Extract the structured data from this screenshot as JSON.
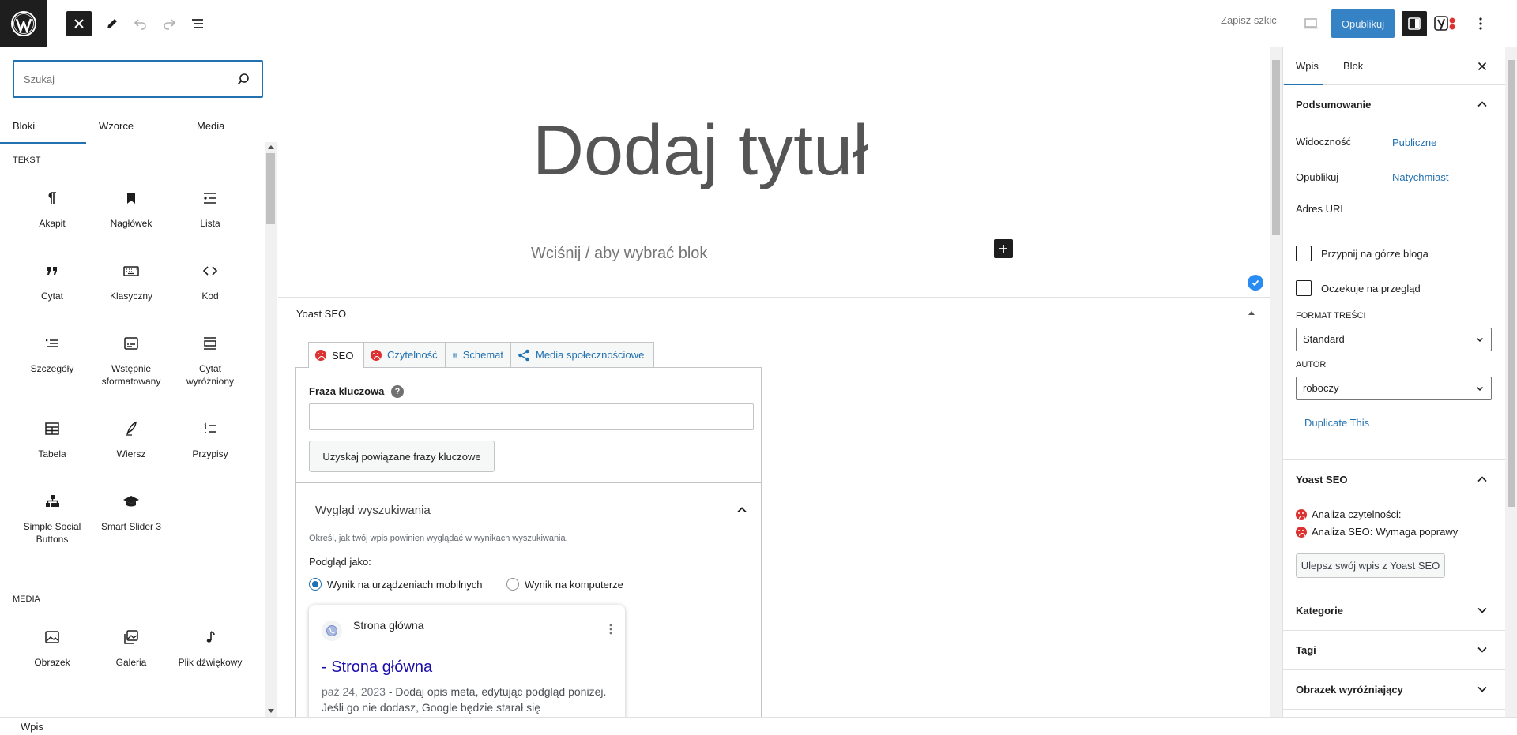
{
  "topbar": {
    "save_draft": "Zapisz szkic",
    "publish": "Opublikuj"
  },
  "inserter": {
    "search_placeholder": "Szukaj",
    "tabs": [
      "Bloki",
      "Wzorce",
      "Media"
    ],
    "categories": {
      "text": "TEKST",
      "media": "MEDIA"
    },
    "text_blocks": [
      {
        "label": "Akapit",
        "icon": "paragraph-icon"
      },
      {
        "label": "Nagłówek",
        "icon": "heading-icon"
      },
      {
        "label": "Lista",
        "icon": "list-icon"
      },
      {
        "label": "Cytat",
        "icon": "quote-icon"
      },
      {
        "label": "Klasyczny",
        "icon": "classic-icon"
      },
      {
        "label": "Kod",
        "icon": "code-icon"
      },
      {
        "label": "Szczegóły",
        "icon": "details-icon"
      },
      {
        "label": "Wstępnie sformatowany",
        "icon": "preformatted-icon"
      },
      {
        "label": "Cytat wyróżniony",
        "icon": "pullquote-icon"
      },
      {
        "label": "Tabela",
        "icon": "table-icon"
      },
      {
        "label": "Wiersz",
        "icon": "verse-icon"
      },
      {
        "label": "Przypisy",
        "icon": "footnotes-icon"
      },
      {
        "label": "Simple Social Buttons",
        "icon": "social-buttons-icon"
      },
      {
        "label": "Smart Slider 3",
        "icon": "slider-icon"
      }
    ],
    "media_blocks": [
      {
        "label": "Obrazek",
        "icon": "image-icon"
      },
      {
        "label": "Galeria",
        "icon": "gallery-icon"
      },
      {
        "label": "Plik dźwiękowy",
        "icon": "audio-icon"
      }
    ]
  },
  "editor": {
    "title_placeholder": "Dodaj tytuł",
    "block_hint": "Wciśnij / aby wybrać blok"
  },
  "yoast_metabox": {
    "title": "Yoast SEO",
    "tabs": [
      "SEO",
      "Czytelność",
      "Schemat",
      "Media społecznościowe"
    ],
    "keyphrase_label": "Fraza kluczowa",
    "help_glyph": "?",
    "related_button": "Uzyskaj powiązane frazy kluczowe",
    "search_appearance_title": "Wygląd wyszukiwania",
    "search_appearance_desc": "Określ, jak twój wpis powinien wyglądać w wynikach wyszukiwania.",
    "preview_as": "Podgląd jako:",
    "radio_mobile": "Wynik na urządzeniach mobilnych",
    "radio_desktop": "Wynik na komputerze",
    "serp": {
      "site_name": "Strona główna",
      "link": "- Strona główna",
      "date": "paź 24, 2023",
      "snippet": "  -  Dodaj opis meta, edytując podgląd poniżej. Jeśli go nie dodasz, Google będzie starał się"
    }
  },
  "sidebar": {
    "tabs": [
      "Wpis",
      "Blok"
    ],
    "summary_title": "Podsumowanie",
    "visibility_label": "Widoczność",
    "visibility_value": "Publiczne",
    "publish_label": "Opublikuj",
    "publish_value": "Natychmiast",
    "url_label": "Adres URL",
    "sticky_label": "Przypnij na górze bloga",
    "pending_label": "Oczekuje na przegląd",
    "format_label": "FORMAT TREŚCI",
    "format_value": "Standard",
    "author_label": "AUTOR",
    "author_value": "roboczy",
    "duplicate_link": "Duplicate This",
    "yoast_title": "Yoast SEO",
    "readability_label": "Analiza czytelności:",
    "seo_label": "Analiza SEO:",
    "seo_value": "Wymaga poprawy",
    "improve_button": "Ulepsz swój wpis z Yoast SEO",
    "categories_title": "Kategorie",
    "tags_title": "Tagi",
    "featured_image_title": "Obrazek wyróżniający"
  },
  "footer": {
    "breadcrumb": "Wpis"
  },
  "colors": {
    "accent": "#2271b1",
    "publish_bg": "#3582c4",
    "dark": "#1e1e1e",
    "yoast_bad": "#dc3232"
  }
}
